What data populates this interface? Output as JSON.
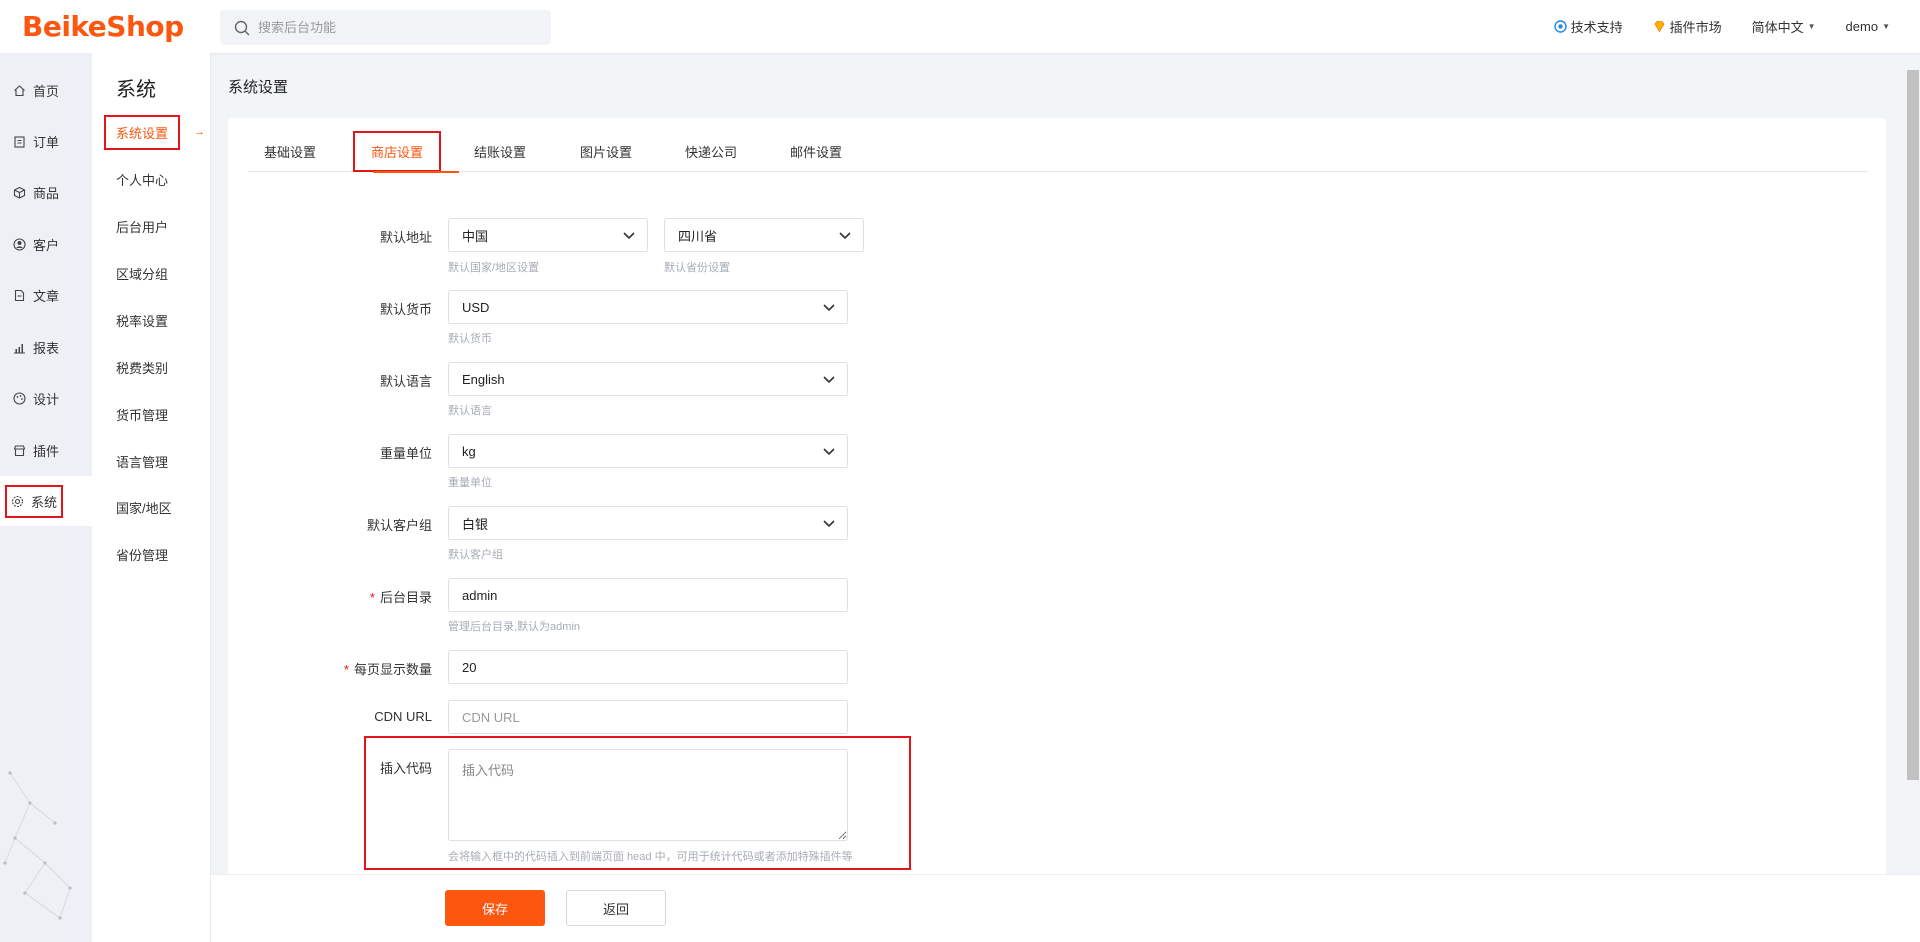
{
  "app": {
    "logo": "BeikeShop"
  },
  "header": {
    "search_placeholder": "搜索后台功能",
    "links": [
      {
        "label": "技术支持",
        "icon": "support-icon"
      },
      {
        "label": "插件市场",
        "icon": "diamond-icon"
      }
    ],
    "language": "简体中文",
    "user": "demo"
  },
  "leftnav": {
    "items": [
      {
        "label": "首页",
        "icon": "home-icon"
      },
      {
        "label": "订单",
        "icon": "clipboard-icon"
      },
      {
        "label": "商品",
        "icon": "box-icon"
      },
      {
        "label": "客户",
        "icon": "user-icon"
      },
      {
        "label": "文章",
        "icon": "document-icon"
      },
      {
        "label": "报表",
        "icon": "bar-chart-icon"
      },
      {
        "label": "设计",
        "icon": "palette-icon"
      },
      {
        "label": "插件",
        "icon": "plugin-icon"
      },
      {
        "label": "系统",
        "icon": "gear-icon",
        "active": true
      }
    ]
  },
  "subnav": {
    "title": "系统",
    "items": [
      "系统设置",
      "个人中心",
      "后台用户",
      "区域分组",
      "税率设置",
      "税费类别",
      "货币管理",
      "语言管理",
      "国家/地区",
      "省份管理"
    ]
  },
  "page": {
    "title": "系统设置"
  },
  "tabs": [
    "基础设置",
    "商店设置",
    "结账设置",
    "图片设置",
    "快递公司",
    "邮件设置"
  ],
  "form": {
    "address": {
      "label": "默认地址",
      "country": "中国",
      "country_hint": "默认国家/地区设置",
      "province": "四川省",
      "province_hint": "默认省份设置"
    },
    "currency": {
      "label": "默认货币",
      "value": "USD",
      "hint": "默认货币"
    },
    "language": {
      "label": "默认语言",
      "value": "English",
      "hint": "默认语言"
    },
    "weight": {
      "label": "重量单位",
      "value": "kg",
      "hint": "重量单位"
    },
    "customer_group": {
      "label": "默认客户组",
      "value": "白银",
      "hint": "默认客户组"
    },
    "admin_dir": {
      "label": "后台目录",
      "value": "admin",
      "hint": "管理后台目录,默认为admin"
    },
    "per_page": {
      "label": "每页显示数量",
      "value": "20"
    },
    "cdn": {
      "label": "CDN URL",
      "placeholder": "CDN URL"
    },
    "code": {
      "label": "插入代码",
      "placeholder": "插入代码",
      "hint": "会将输入框中的代码插入到前端页面 head 中，可用于统计代码或者添加特殊插件等"
    }
  },
  "footer": {
    "save": "保存",
    "back": "返回"
  },
  "colors": {
    "brand": "#fd560f",
    "highlight": "#e4141b"
  }
}
